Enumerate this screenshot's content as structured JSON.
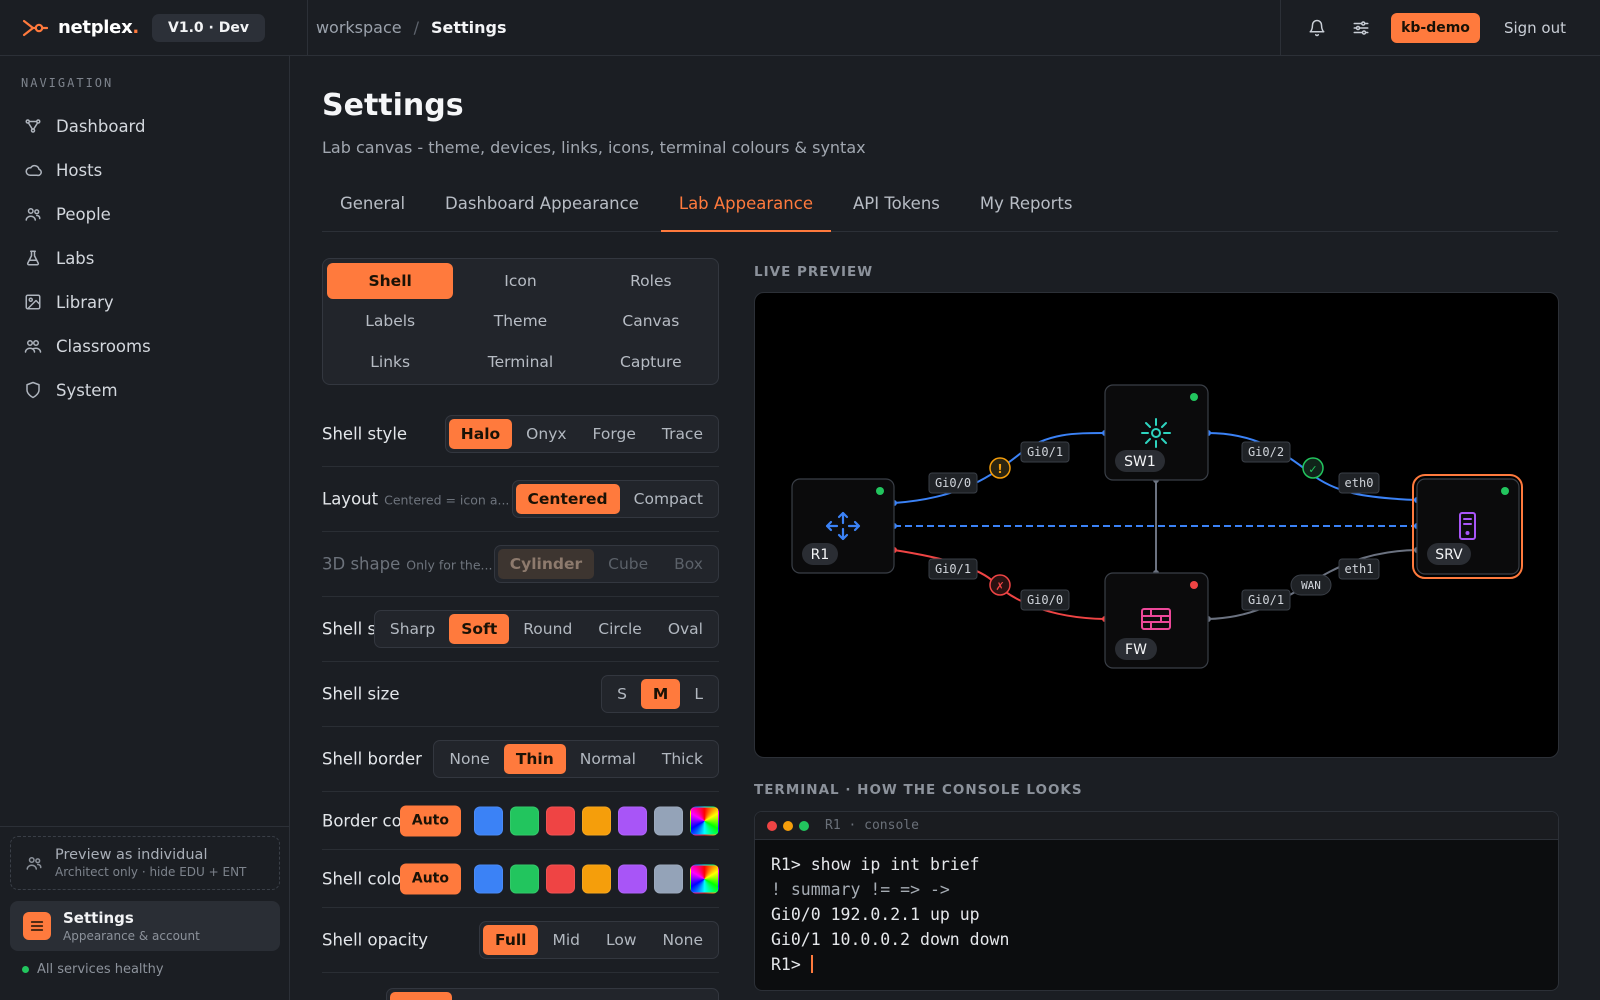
{
  "topbar": {
    "brand": "netplex",
    "brand_dot": ".",
    "version": "V1.0 · Dev",
    "breadcrumb": {
      "root": "workspace",
      "sep": "/",
      "current": "Settings"
    },
    "user": "kb-demo",
    "signout": "Sign out"
  },
  "sidebar": {
    "heading": "NAVIGATION",
    "items": [
      {
        "label": "Dashboard",
        "icon": "topology-icon"
      },
      {
        "label": "Hosts",
        "icon": "cloud-icon"
      },
      {
        "label": "People",
        "icon": "people-icon"
      },
      {
        "label": "Labs",
        "icon": "flask-icon"
      },
      {
        "label": "Library",
        "icon": "image-icon"
      },
      {
        "label": "Classrooms",
        "icon": "classroom-icon"
      },
      {
        "label": "System",
        "icon": "shield-icon"
      }
    ],
    "preview": {
      "title": "Preview as individual",
      "subtitle": "Architect only · hide EDU + ENT"
    },
    "settings": {
      "title": "Settings",
      "subtitle": "Appearance & account"
    },
    "health": "All services healthy"
  },
  "page": {
    "title": "Settings",
    "subtitle": "Lab canvas - theme, devices, links, icons, terminal colours & syntax",
    "tabs": [
      "General",
      "Dashboard Appearance",
      "Lab Appearance",
      "API Tokens",
      "My Reports"
    ],
    "active_tab": "Lab Appearance"
  },
  "subnav": {
    "items": [
      "Shell",
      "Icon",
      "Roles",
      "Labels",
      "Theme",
      "Canvas",
      "Links",
      "Terminal",
      "Capture"
    ],
    "active": "Shell"
  },
  "settings": {
    "shell_style": {
      "label": "Shell style",
      "options": [
        "Halo",
        "Onyx",
        "Forge",
        "Trace"
      ],
      "selected": "Halo"
    },
    "layout": {
      "label": "Layout",
      "hint": "Centered = icon a...",
      "options": [
        "Centered",
        "Compact"
      ],
      "selected": "Centered"
    },
    "shape_3d": {
      "label": "3D shape",
      "hint": "Only for the...",
      "options": [
        "Cylinder",
        "Cube",
        "Box"
      ],
      "selected": "Cylinder"
    },
    "shell_shape": {
      "label": "Shell s",
      "options": [
        "Sharp",
        "Soft",
        "Round",
        "Circle",
        "Oval"
      ],
      "selected": "Soft"
    },
    "shell_size": {
      "label": "Shell size",
      "options": [
        "S",
        "M",
        "L"
      ],
      "selected": "M"
    },
    "shell_border": {
      "label": "Shell border",
      "options": [
        "None",
        "Thin",
        "Normal",
        "Thick"
      ],
      "selected": "Thin"
    },
    "border_colour": {
      "label": "Border colo",
      "auto": "Auto"
    },
    "shell_colour": {
      "label": "Shell colou",
      "auto": "Auto"
    },
    "shell_opacity": {
      "label": "Shell opacity",
      "options": [
        "Full",
        "Mid",
        "Low",
        "None"
      ],
      "selected": "Full"
    },
    "swatch_colors": [
      "#3b82f6",
      "#22c55e",
      "#ef4444",
      "#f59e0b",
      "#a855f7",
      "#94a3b8"
    ]
  },
  "preview": {
    "heading": "LIVE PREVIEW",
    "nodes": {
      "r1": "R1",
      "sw1": "SW1",
      "fw": "FW",
      "srv": "SRV"
    },
    "ports": {
      "r1_top": "Gi0/0",
      "sw1_left": "Gi0/1",
      "sw1_right": "Gi0/2",
      "srv_left": "eth0",
      "r1_bottom": "Gi0/1",
      "fw_left": "Gi0/0",
      "fw_right": "Gi0/1",
      "wan": "WAN",
      "srv_bottom": "eth1"
    },
    "markers": {
      "warn": "!",
      "ok": "✓",
      "down": "✗"
    },
    "colors": {
      "up": "#3b82f6",
      "down": "#ef4444",
      "idle": "#6b7280",
      "accent": "#ff7a3d",
      "online": "#22c55e"
    }
  },
  "terminal": {
    "heading": "TERMINAL · HOW THE CONSOLE LOOKS",
    "title": "R1 · console",
    "lines": [
      "R1> show ip int brief",
      "! summary != => ->",
      "Gi0/0 192.0.2.1 up up",
      "Gi0/1 10.0.0.2 down down",
      "R1> "
    ]
  }
}
